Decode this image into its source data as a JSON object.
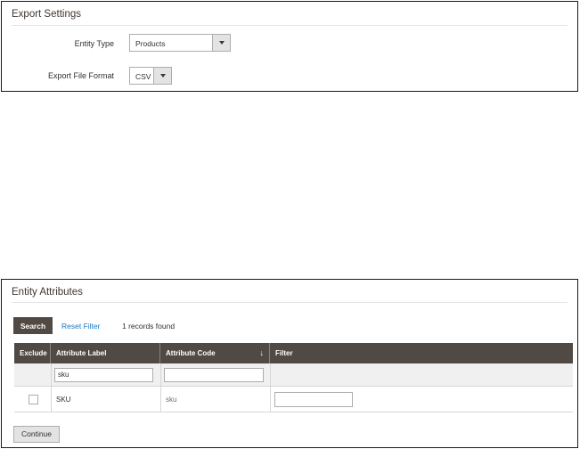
{
  "export_settings": {
    "title": "Export Settings",
    "entity_type": {
      "label": "Entity Type",
      "value": "Products"
    },
    "file_format": {
      "label": "Export File Format",
      "value": "CSV"
    }
  },
  "entity_attributes": {
    "title": "Entity Attributes",
    "search_label": "Search",
    "reset_filter_label": "Reset Filter",
    "records_found": "1 records found",
    "columns": [
      "Exclude",
      "Attribute Label",
      "Attribute Code",
      "Filter"
    ],
    "sort_indicator": "↓",
    "filters": {
      "attribute_label": "sku",
      "attribute_code": ""
    },
    "rows": [
      {
        "exclude": false,
        "attribute_label": "SKU",
        "attribute_code": "sku",
        "filter_value": ""
      }
    ],
    "continue_label": "Continue"
  }
}
